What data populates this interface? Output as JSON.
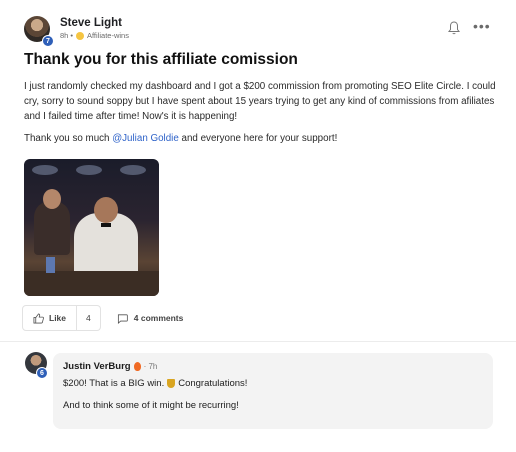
{
  "post": {
    "author": "Steve Light",
    "level": "7",
    "time": "8h",
    "separator": "•",
    "category": "Affiliate-wins",
    "title": "Thank you for this affiliate comission",
    "body": "I just randomly checked my dashboard and I got a $200 commission from promoting SEO Elite Circle. I could cry, sorry to sound soppy but I have spent about 15 years trying to get any kind of commissions from afiliates and I failed time after time! Now's it is happening!",
    "thanks_prefix": "Thank you so much ",
    "thanks_mention": "@Julian Goldie",
    "thanks_suffix": " and everyone here for your support!",
    "more_glyph": "•••"
  },
  "actions": {
    "like_label": "Like",
    "like_count": "4",
    "comments_label": "4 comments"
  },
  "comment": {
    "author": "Justin VerBurg",
    "level": "6",
    "time": "· 7h",
    "line1_a": "$200! That is a BIG win.",
    "line1_b": "Congratulations!",
    "line2": "And to think some of it might be recurring!"
  },
  "colors": {
    "accent": "#2f63c9",
    "badge": "#2e5fb8"
  }
}
